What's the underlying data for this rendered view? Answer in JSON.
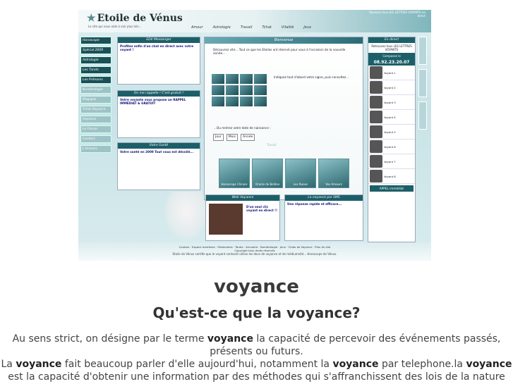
{
  "screenshot": {
    "logo": "Etoile de Vénus",
    "logo_tagline": "Le site qui vous aide à voir plus loin...",
    "topnav": [
      "Amour",
      "Astrologie",
      "Travail",
      "Tchat",
      "Vitalité",
      "Jeux"
    ],
    "banner_text": "Recevez tous LES LETTRES VOYANTS en direct",
    "leftnav": [
      "Horoscope",
      "Spécial 2009",
      "Astrologie",
      "Les Tarots",
      "Les Prénoms",
      "Numérologie",
      "Magique",
      "Tchat Voyance",
      "Voyance",
      "Le Forum",
      "Contact",
      "L'Univers"
    ],
    "panel_edv": {
      "title": "EDV Messenger",
      "text": "Profitez enfin d'un chat en direct avec votre voyant !"
    },
    "panel_rappel": {
      "title": "On me rappelle ! C'est gratuit !",
      "text": "Votre voyante vous propose un RAPPEL IMMÉDIAT & GRATUIT"
    },
    "panel_sante": {
      "title": "Votre Santé",
      "text": "Votre santé en 2009 Tout vous est dévoilé..."
    },
    "center": {
      "title": "Bienvenue",
      "intro": "Découvrez vite... Tout ce que les Etoiles ont réservé pour vous à l'occasion de la nouvelle année...",
      "hint": "Indiquez tout d'abord votre signe, puis consultez...",
      "select_prompt": "...Ou rentrez votre date de naissance :",
      "select_day": "Jour",
      "select_month": "Mois",
      "select_year": "Année",
      "travail": "Travail",
      "cards": [
        "Horoscope Chinois",
        "Oracle de Belline",
        "Les Runes",
        "Vos Amours"
      ]
    },
    "panel_voyance": {
      "title": "Web Voyance",
      "text": "D'un seul clic voyant en direct !!"
    },
    "panel_sms": {
      "title": "La voyance par SMS",
      "text": "Une réponse rapide et efficace..."
    },
    "right": {
      "title": "En direct",
      "header": "Retrouvez tous LES LETTRES VOYANTS",
      "date_label": "Composez le",
      "phone": "08.92.23.20.07",
      "voyants": [
        "Voyant 1",
        "Voyant 2",
        "Voyant 3",
        "Voyant 4",
        "Voyant 5",
        "Voyant 6",
        "Voyant 7",
        "Voyant 8"
      ],
      "footer_box": "APPEL immédiat"
    },
    "footer": "Contact · Espace membres · Partenaires · Tarots · Annuaire · Numérologie · Jeux · Chats de Voyance · Plan du site",
    "copyright": "Copyright tous droits réservés"
  },
  "caption": "Etoile de Vénus certifie que le voyant contacté utilise les dons de voyance et de médiumnité... Horoscope de Vénus.",
  "page": {
    "heading": "voyance",
    "subheading": "Qu'est-ce que la voyance?",
    "p1_before": "Au sens strict, on désigne par le terme ",
    "p1_bold": "voyance",
    "p1_after": " la capacité de percevoir des événements passés, présents ou futurs.",
    "p2_a": "La ",
    "p2_b": "voyance",
    "p2_c": " fait beaucoup parler d'elle aujourd'hui, notamment la ",
    "p2_d": "voyance",
    "p2_e": " par telephone.la ",
    "p2_f": "voyance",
    "p2_g": " est la capacité d'obtenir une information par des méthodes qui s'affranchissent des lois de la nature"
  }
}
